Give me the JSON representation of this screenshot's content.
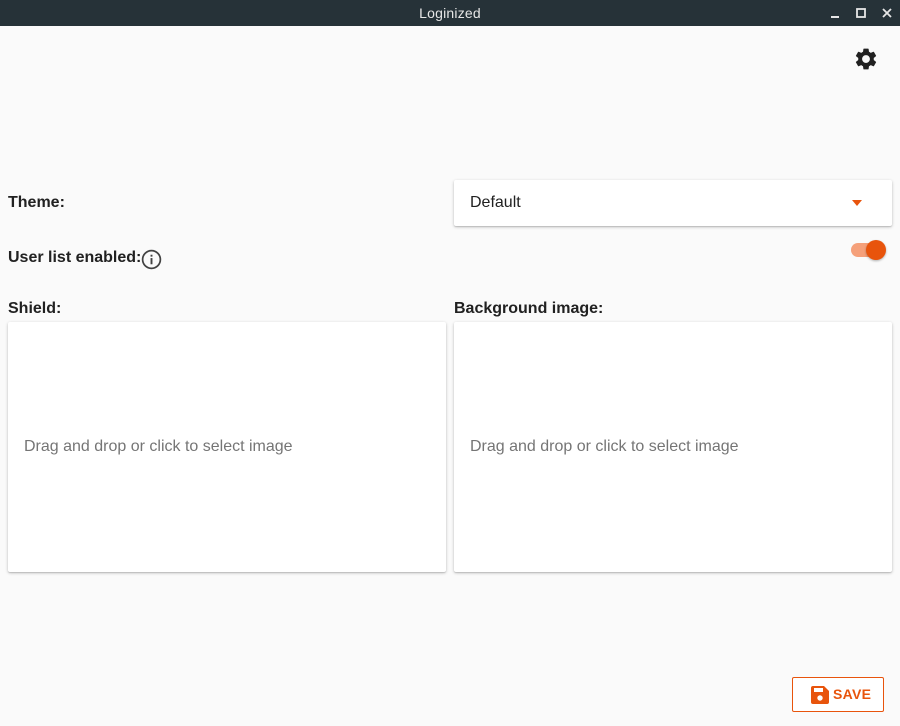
{
  "window": {
    "title": "Loginized",
    "controls": [
      "minimize",
      "maximize",
      "close"
    ]
  },
  "header": {
    "settings_icon": "gear-icon"
  },
  "theme": {
    "label": "Theme:",
    "selected": "Default",
    "dropdown_icon": "caret-down-icon"
  },
  "user_list": {
    "label": "User list enabled:",
    "info_icon": "info-icon",
    "enabled": true
  },
  "shield": {
    "label": "Shield:",
    "placeholder": "Drag and drop or click to select image"
  },
  "background_image": {
    "label": "Background image:",
    "placeholder": "Drag and drop or click to select image"
  },
  "footer": {
    "save_label": "SAVE",
    "save_icon": "floppy-disk-icon"
  },
  "colors": {
    "accent": "#e8540c",
    "accent_light": "#f5a07a",
    "titlebar": "#263238",
    "background": "#fafafa"
  }
}
